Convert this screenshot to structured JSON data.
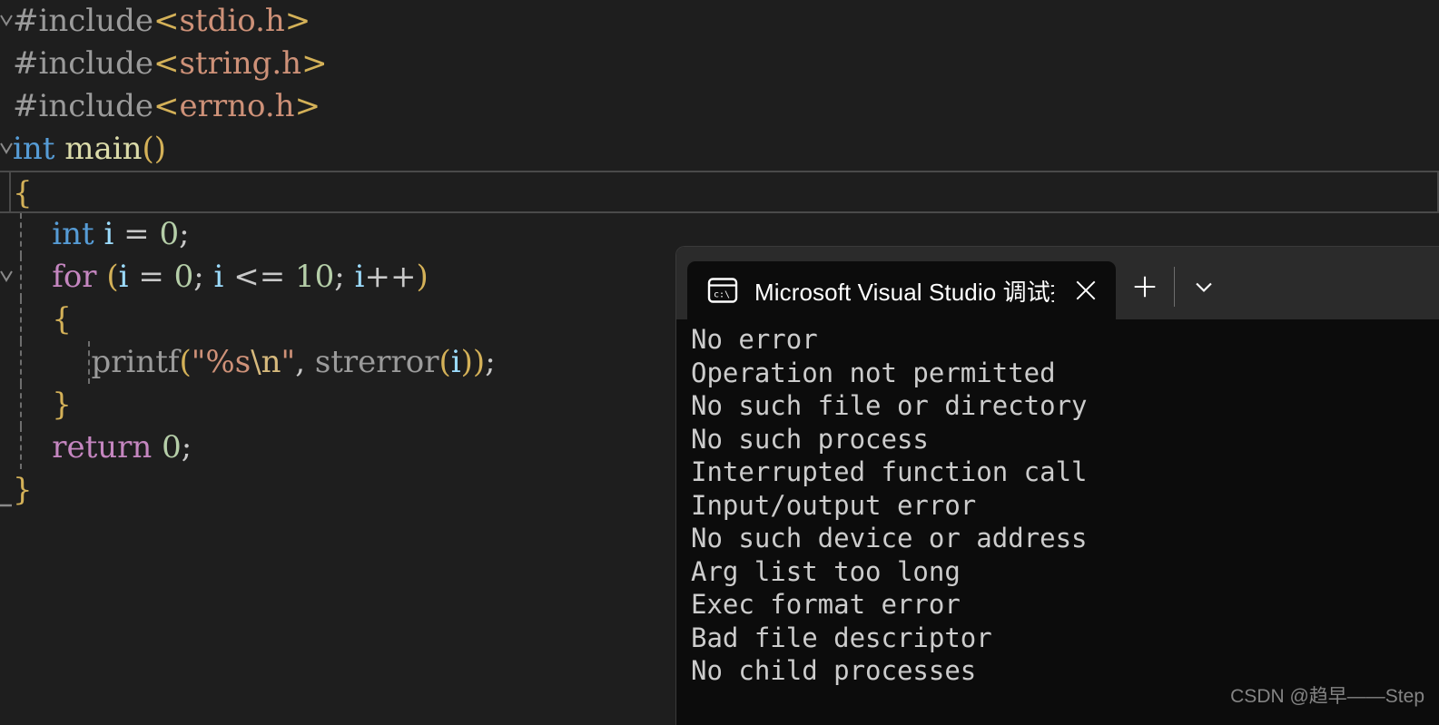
{
  "editor": {
    "language": "c",
    "background": "#1e1e1e",
    "lines": [
      {
        "id": "line-1",
        "fold": "chevron-down",
        "indent": 0,
        "tokens": [
          {
            "cls": "t-pre",
            "text": "#include"
          },
          {
            "cls": "t-angle",
            "text": "<"
          },
          {
            "cls": "t-hdr",
            "text": "stdio.h"
          },
          {
            "cls": "t-angle",
            "text": ">"
          }
        ]
      },
      {
        "id": "line-2",
        "fold": "none",
        "indent": 0,
        "tokens": [
          {
            "cls": "t-pre",
            "text": "#include"
          },
          {
            "cls": "t-angle",
            "text": "<"
          },
          {
            "cls": "t-hdr",
            "text": "string.h"
          },
          {
            "cls": "t-angle",
            "text": ">"
          }
        ]
      },
      {
        "id": "line-3",
        "fold": "none",
        "indent": 0,
        "tokens": [
          {
            "cls": "t-pre",
            "text": "#include"
          },
          {
            "cls": "t-angle",
            "text": "<"
          },
          {
            "cls": "t-hdr",
            "text": "errno.h"
          },
          {
            "cls": "t-angle",
            "text": ">"
          }
        ]
      },
      {
        "id": "line-4",
        "fold": "chevron-down",
        "indent": 0,
        "tokens": [
          {
            "cls": "t-kw",
            "text": "int"
          },
          {
            "cls": "t-plain",
            "text": " "
          },
          {
            "cls": "t-fn",
            "text": "main"
          },
          {
            "cls": "t-punc",
            "text": "()"
          }
        ]
      },
      {
        "id": "line-5",
        "fold": "none",
        "indent": 0,
        "current": true,
        "tokens": [
          {
            "cls": "t-brace",
            "text": "{"
          }
        ]
      },
      {
        "id": "line-6",
        "fold": "none",
        "indent": 1,
        "tokens": [
          {
            "cls": "t-plain",
            "text": "    "
          },
          {
            "cls": "t-kw",
            "text": "int"
          },
          {
            "cls": "t-plain",
            "text": " "
          },
          {
            "cls": "t-var",
            "text": "i"
          },
          {
            "cls": "t-plain",
            "text": " "
          },
          {
            "cls": "t-op",
            "text": "="
          },
          {
            "cls": "t-plain",
            "text": " "
          },
          {
            "cls": "t-num",
            "text": "0"
          },
          {
            "cls": "t-semi",
            "text": ";"
          }
        ]
      },
      {
        "id": "line-7",
        "fold": "chevron-down",
        "indent": 1,
        "tokens": [
          {
            "cls": "t-plain",
            "text": "    "
          },
          {
            "cls": "t-ctl",
            "text": "for"
          },
          {
            "cls": "t-plain",
            "text": " "
          },
          {
            "cls": "t-punc",
            "text": "("
          },
          {
            "cls": "t-var",
            "text": "i"
          },
          {
            "cls": "t-plain",
            "text": " "
          },
          {
            "cls": "t-op",
            "text": "="
          },
          {
            "cls": "t-plain",
            "text": " "
          },
          {
            "cls": "t-num",
            "text": "0"
          },
          {
            "cls": "t-semi",
            "text": ";"
          },
          {
            "cls": "t-plain",
            "text": " "
          },
          {
            "cls": "t-var",
            "text": "i"
          },
          {
            "cls": "t-plain",
            "text": " "
          },
          {
            "cls": "t-op",
            "text": "<="
          },
          {
            "cls": "t-plain",
            "text": " "
          },
          {
            "cls": "t-num",
            "text": "10"
          },
          {
            "cls": "t-semi",
            "text": ";"
          },
          {
            "cls": "t-plain",
            "text": " "
          },
          {
            "cls": "t-var",
            "text": "i"
          },
          {
            "cls": "t-op",
            "text": "++"
          },
          {
            "cls": "t-punc",
            "text": ")"
          }
        ]
      },
      {
        "id": "line-8",
        "fold": "none",
        "indent": 1,
        "tokens": [
          {
            "cls": "t-plain",
            "text": "    "
          },
          {
            "cls": "t-brace",
            "text": "{"
          }
        ]
      },
      {
        "id": "line-9",
        "fold": "none",
        "indent": 2,
        "tokens": [
          {
            "cls": "t-plain",
            "text": "        "
          },
          {
            "cls": "t-pre",
            "text": "printf"
          },
          {
            "cls": "t-punc",
            "text": "("
          },
          {
            "cls": "t-str",
            "text": "\"%s"
          },
          {
            "cls": "t-esc",
            "text": "\\n"
          },
          {
            "cls": "t-str",
            "text": "\""
          },
          {
            "cls": "t-plain",
            "text": ", "
          },
          {
            "cls": "t-pre",
            "text": "strerror"
          },
          {
            "cls": "t-punc",
            "text": "("
          },
          {
            "cls": "t-var",
            "text": "i"
          },
          {
            "cls": "t-punc",
            "text": "))"
          },
          {
            "cls": "t-semi",
            "text": ";"
          }
        ]
      },
      {
        "id": "line-10",
        "fold": "none",
        "indent": 1,
        "tokens": [
          {
            "cls": "t-plain",
            "text": "    "
          },
          {
            "cls": "t-brace",
            "text": "}"
          }
        ]
      },
      {
        "id": "line-11",
        "fold": "none",
        "indent": 1,
        "tokens": [
          {
            "cls": "t-plain",
            "text": "    "
          },
          {
            "cls": "t-ctl",
            "text": "return"
          },
          {
            "cls": "t-plain",
            "text": " "
          },
          {
            "cls": "t-num",
            "text": "0"
          },
          {
            "cls": "t-semi",
            "text": ";"
          }
        ]
      },
      {
        "id": "line-12",
        "fold": "collapse-end",
        "indent": 0,
        "tokens": [
          {
            "cls": "t-brace",
            "text": "}"
          }
        ]
      }
    ]
  },
  "terminal": {
    "tab": {
      "icon": "console-icon",
      "title": "Microsoft Visual Studio 调试挖",
      "close_label": "✕"
    },
    "actions": {
      "new_tab_label": "+",
      "dropdown_label": "⌄"
    },
    "output_lines": [
      "No error",
      "Operation not permitted",
      "No such file or directory",
      "No such process",
      "Interrupted function call",
      "Input/output error",
      "No such device or address",
      "Arg list too long",
      "Exec format error",
      "Bad file descriptor",
      "No child processes"
    ],
    "colors": {
      "titlebar": "#2b2b2b",
      "body": "#0c0c0c",
      "text": "#cccccc"
    }
  },
  "watermark": {
    "text": "CSDN @趋早——Step"
  }
}
